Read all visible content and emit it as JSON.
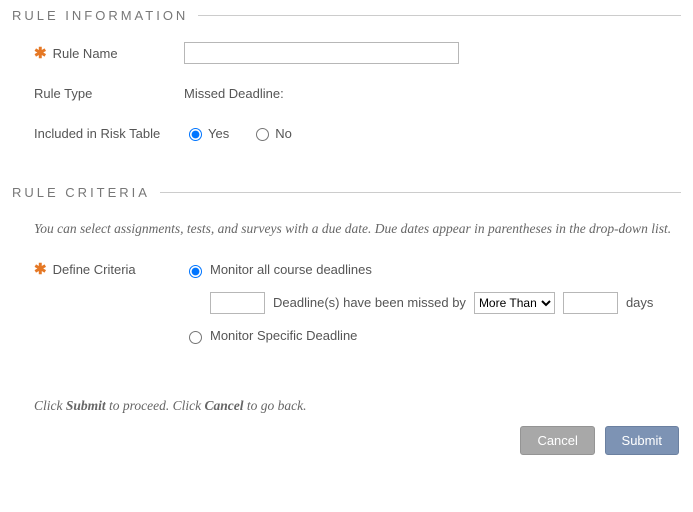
{
  "sections": {
    "ruleInfo": {
      "title": "RULE INFORMATION"
    },
    "ruleCriteria": {
      "title": "RULE CRITERIA"
    }
  },
  "ruleInfo": {
    "ruleNameLabel": "Rule Name",
    "ruleNameValue": "",
    "ruleTypeLabel": "Rule Type",
    "ruleTypeValue": "Missed Deadline:",
    "riskTableLabel": "Included in Risk Table",
    "riskYes": "Yes",
    "riskNo": "No"
  },
  "criteria": {
    "hint": "You can select assignments, tests, and surveys with a due date. Due dates appear in parentheses in the drop-down list.",
    "defineLabel": "Define Criteria",
    "optAllLabel": "Monitor all course deadlines",
    "countValue": "",
    "deadlinesPhrase": "Deadline(s) have been missed by",
    "compareSelected": "More Than",
    "daysValue": "",
    "daysSuffix": "days",
    "optSpecificLabel": "Monitor Specific Deadline"
  },
  "footer": {
    "hintPrefix": "Click ",
    "submitWord": "Submit",
    "hintMid": " to proceed. Click ",
    "cancelWord": "Cancel",
    "hintSuffix": " to go back.",
    "cancelBtn": "Cancel",
    "submitBtn": "Submit"
  }
}
